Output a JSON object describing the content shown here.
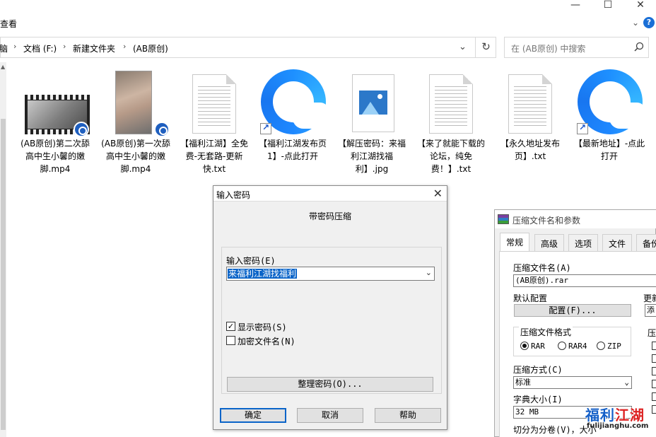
{
  "ribbon": {
    "tab_view": "查看",
    "help": "?"
  },
  "address": {
    "crumbs": [
      "脑",
      "文档 (F:)",
      "新建文件夹",
      "(AB原创)"
    ],
    "separator": "›",
    "search_placeholder": "在 (AB原创) 中搜索"
  },
  "files": [
    {
      "label": "(AB原创)第二次舔高中生小馨的嫩脚.mp4",
      "kind": "video"
    },
    {
      "label": "(AB原创)第一次舔高中生小馨的嫩脚.mp4",
      "kind": "video-portrait"
    },
    {
      "label": "【福利江湖】全免费-无套路-更新快.txt",
      "kind": "text"
    },
    {
      "label": "【福利江湖发布页1】-点此打开",
      "kind": "browser-shortcut"
    },
    {
      "label": "【解压密码：来福利江湖找福利】.jpg",
      "kind": "image"
    },
    {
      "label": "【来了就能下载的论坛，纯免费！】.txt",
      "kind": "text"
    },
    {
      "label": "【永久地址发布页】.txt",
      "kind": "text"
    },
    {
      "label": "【最新地址】-点此打开",
      "kind": "browser-shortcut"
    }
  ],
  "password_dialog": {
    "title": "输入密码",
    "heading": "带密码压缩",
    "password_label": "输入密码(E)",
    "password_value": "来福利江湖找福利",
    "show_password_label": "显示密码(S)",
    "show_password_checked": true,
    "encrypt_names_label": "加密文件名(N)",
    "encrypt_names_checked": false,
    "organize_button": "整理密码(O)...",
    "ok_button": "确定",
    "cancel_button": "取消",
    "help_button": "帮助"
  },
  "rar_dialog": {
    "title": "压缩文件名和参数",
    "tabs": [
      "常规",
      "高级",
      "选项",
      "文件",
      "备份"
    ],
    "archive_name_label": "压缩文件名(A)",
    "archive_name_value": "(AB原创).rar",
    "default_profile_label": "默认配置",
    "profile_button": "配置(F)...",
    "update_label": "更新",
    "add_button": "添",
    "format_label": "压缩文件格式",
    "formats": [
      "RAR",
      "RAR4",
      "ZIP"
    ],
    "selected_format": "RAR",
    "options_label": "压",
    "method_label": "压缩方式(C)",
    "method_value": "标准",
    "dict_label": "字典大小(I)",
    "dict_value": "32 MB",
    "split_label": "切分为分卷(V)，大小"
  },
  "watermark": {
    "cn_a": "福利",
    "cn_b": "江湖",
    "en": "fulijianghu.com"
  },
  "colors": {
    "accent": "#0a64c8",
    "help_blue": "#1a6fd6"
  }
}
